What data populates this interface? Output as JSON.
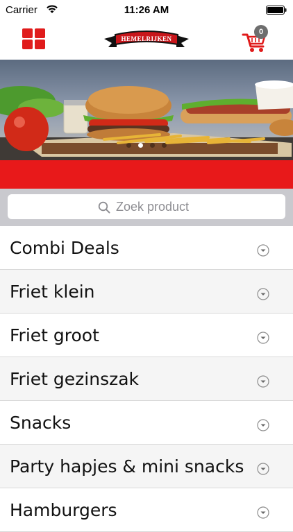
{
  "status_bar": {
    "carrier": "Carrier",
    "time": "11:26 AM"
  },
  "header": {
    "menu_icon": "grid-icon",
    "logo_text": "HEMELRIJKEN",
    "cart_icon": "shopping-cart-icon",
    "cart_count": "0"
  },
  "colors": {
    "brand_red": "#e8191a",
    "text": "#111111",
    "placeholder": "#8e8e93"
  },
  "banner": {
    "slide_count": 4,
    "active_slide": 2
  },
  "search": {
    "placeholder": "Zoek product"
  },
  "categories": [
    {
      "label": "Combi Deals"
    },
    {
      "label": "Friet klein"
    },
    {
      "label": "Friet groot"
    },
    {
      "label": "Friet gezinszak"
    },
    {
      "label": "Snacks"
    },
    {
      "label": "Party hapjes & mini snacks"
    },
    {
      "label": "Hamburgers"
    }
  ]
}
